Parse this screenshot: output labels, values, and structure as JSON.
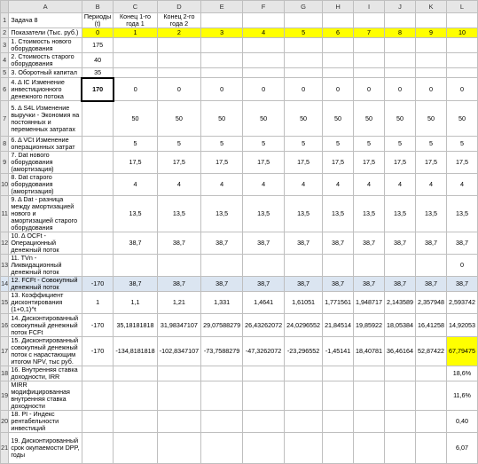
{
  "columns": [
    "A",
    "B",
    "C",
    "D",
    "E",
    "F",
    "G",
    "H",
    "I",
    "J",
    "K",
    "L"
  ],
  "rows": [
    {
      "n": "1",
      "cells": [
        "Задача 8",
        "Периоды (t)",
        "Конец 1-го года 1",
        "Конец 2-го года 2",
        "",
        "",
        "",
        "",
        "",
        "",
        "",
        ""
      ]
    },
    {
      "n": "2",
      "cells": [
        "Показатели (Тыс. руб.)",
        "0",
        "1",
        "2",
        "3",
        "4",
        "5",
        "6",
        "7",
        "8",
        "9",
        "10"
      ]
    },
    {
      "n": "3",
      "cells": [
        "1. Стоимость нового оборудования",
        "175",
        "",
        "",
        "",
        "",
        "",
        "",
        "",
        "",
        "",
        ""
      ]
    },
    {
      "n": "4",
      "cells": [
        "2. Стоимость старого оборудования",
        "40",
        "",
        "",
        "",
        "",
        "",
        "",
        "",
        "",
        "",
        ""
      ]
    },
    {
      "n": "5",
      "cells": [
        "3. Оборотный капитал",
        "35",
        "",
        "",
        "",
        "",
        "",
        "",
        "",
        "",
        "",
        ""
      ]
    },
    {
      "n": "6",
      "cells": [
        "4. Δ IC Изменение инвестиционного денежного потока",
        "170",
        "0",
        "0",
        "0",
        "0",
        "0",
        "0",
        "0",
        "0",
        "0",
        "0"
      ]
    },
    {
      "n": "7",
      "cells": [
        "5. Δ S4L Изменение выручки - Экономия на постоянных и переменных затратах",
        "",
        "50",
        "50",
        "50",
        "50",
        "50",
        "50",
        "50",
        "50",
        "50",
        "50"
      ]
    },
    {
      "n": "8",
      "cells": [
        "6. Δ VCt Изменение операционных затрат",
        "",
        "5",
        "5",
        "5",
        "5",
        "5",
        "5",
        "5",
        "5",
        "5",
        "5"
      ]
    },
    {
      "n": "9",
      "cells": [
        "7. Dat нового оборудования (амортизация)",
        "",
        "17,5",
        "17,5",
        "17,5",
        "17,5",
        "17,5",
        "17,5",
        "17,5",
        "17,5",
        "17,5",
        "17,5"
      ]
    },
    {
      "n": "10",
      "cells": [
        "8. Dat старого оборудования (амортизация)",
        "",
        "4",
        "4",
        "4",
        "4",
        "4",
        "4",
        "4",
        "4",
        "4",
        "4"
      ]
    },
    {
      "n": "11",
      "cells": [
        "9. Δ Dat - разница между амортизацией нового и амортизацией старого оборудования",
        "",
        "13,5",
        "13,5",
        "13,5",
        "13,5",
        "13,5",
        "13,5",
        "13,5",
        "13,5",
        "13,5",
        "13,5"
      ]
    },
    {
      "n": "12",
      "cells": [
        "10. Δ OCFt - Операционный денежный поток",
        "",
        "38,7",
        "38,7",
        "38,7",
        "38,7",
        "38,7",
        "38,7",
        "38,7",
        "38,7",
        "38,7",
        "38,7"
      ]
    },
    {
      "n": "13",
      "cells": [
        "11. TVn - Ликвидационный денежный поток",
        "",
        "",
        "",
        "",
        "",
        "",
        "",
        "",
        "",
        "",
        "0"
      ]
    },
    {
      "n": "14",
      "cells": [
        "12. FCFt - Совокупный денежный поток",
        "-170",
        "38,7",
        "38,7",
        "38,7",
        "38,7",
        "38,7",
        "38,7",
        "38,7",
        "38,7",
        "38,7",
        "38,7"
      ]
    },
    {
      "n": "15",
      "cells": [
        "13. Коэффициент дисконтирования (1+0,1)^t",
        "1",
        "1,1",
        "1,21",
        "1,331",
        "1,4641",
        "1,61051",
        "1,771561",
        "1,948717",
        "2,143589",
        "2,357948",
        "2,593742"
      ]
    },
    {
      "n": "16",
      "cells": [
        "14. Дисконтированный совокупный денежный поток FCFt",
        "-170",
        "35,18181818",
        "31,98347107",
        "29,07588279",
        "26,43262072",
        "24,0296552",
        "21,84514",
        "19,85922",
        "18,05384",
        "16,41258",
        "14,92053"
      ]
    },
    {
      "n": "17",
      "cells": [
        "15. Дисконтированный совокупный денежный поток с нарастающим итогом NPV, тыс руб.",
        "-170",
        "-134,8181818",
        "-102,8347107",
        "-73,7588279",
        "-47,3262072",
        "-23,296552",
        "-1,45141",
        "18,40781",
        "36,46164",
        "52,87422",
        "67,79475"
      ]
    },
    {
      "n": "18",
      "cells": [
        "16. Внутренняя ставка доходности, IRR",
        "",
        "",
        "",
        "",
        "",
        "",
        "",
        "",
        "",
        "",
        "18,6%"
      ]
    },
    {
      "n": "19",
      "cells": [
        "MIRR модифицированная внутренняя ставка доходности",
        "",
        "",
        "",
        "",
        "",
        "",
        "",
        "",
        "",
        "",
        "11,6%"
      ]
    },
    {
      "n": "20",
      "cells": [
        "18. PI - Индекс рентабельности инвестиций",
        "",
        "",
        "",
        "",
        "",
        "",
        "",
        "",
        "",
        "",
        "0,40"
      ]
    },
    {
      "n": "21",
      "cells": [
        "19. Дисконтированный срок окупаемости DPP, годы",
        "",
        "",
        "",
        "",
        "",
        "",
        "",
        "",
        "",
        "",
        "6,07"
      ]
    }
  ]
}
